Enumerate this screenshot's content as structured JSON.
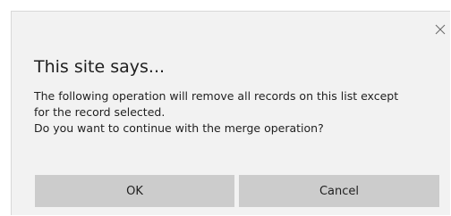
{
  "dialog": {
    "title": "This site says...",
    "message_lines": [
      "The following operation will remove all records on this list except",
      "for the record selected.",
      "Do you want to continue with the merge operation?"
    ],
    "ok_label": "OK",
    "cancel_label": "Cancel",
    "close_icon": "close-icon"
  },
  "colors": {
    "dialog_background": "#f2f2f2",
    "button_background": "#cccccc",
    "text": "#1f1f1f"
  }
}
